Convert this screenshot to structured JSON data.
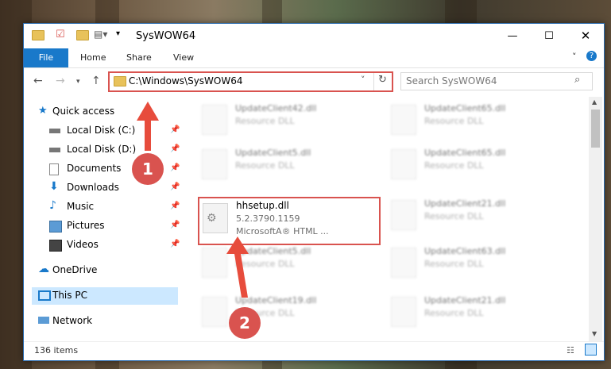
{
  "window": {
    "title": "SysWOW64"
  },
  "ribbon": {
    "file": "File",
    "home": "Home",
    "share": "Share",
    "view": "View"
  },
  "address": {
    "path": "C:\\Windows\\SysWOW64"
  },
  "search": {
    "placeholder": "Search SysWOW64"
  },
  "sidebar": {
    "items": [
      {
        "label": "Quick access",
        "icon": "star-icon"
      },
      {
        "label": "Local Disk (C:)",
        "icon": "drive-icon"
      },
      {
        "label": "Local Disk (D:)",
        "icon": "drive-icon"
      },
      {
        "label": "Documents",
        "icon": "document-icon"
      },
      {
        "label": "Downloads",
        "icon": "download-icon"
      },
      {
        "label": "Music",
        "icon": "music-icon"
      },
      {
        "label": "Pictures",
        "icon": "picture-icon"
      },
      {
        "label": "Videos",
        "icon": "video-icon"
      },
      {
        "label": "OneDrive",
        "icon": "cloud-icon"
      },
      {
        "label": "This PC",
        "icon": "computer-icon"
      },
      {
        "label": "Network",
        "icon": "network-icon"
      }
    ]
  },
  "files": [
    {
      "name": "UpdateClient42.dll",
      "desc": "Resource DLL"
    },
    {
      "name": "UpdateClient65.dll",
      "desc": "Resource DLL"
    },
    {
      "name": "UpdateClient5.dll",
      "desc": "Resource DLL"
    },
    {
      "name": "UpdateClient65.dll",
      "desc": "Resource DLL"
    },
    {
      "name": "hhsetup.dll",
      "version": "5.2.3790.1159",
      "desc": "MicrosoftA® HTML ..."
    },
    {
      "name": "UpdateClient21.dll",
      "desc": "Resource DLL"
    },
    {
      "name": "UpdateClient5.dll",
      "desc": "Resource DLL"
    },
    {
      "name": "UpdateClient63.dll",
      "desc": "Resource DLL"
    },
    {
      "name": "UpdateClient19.dll",
      "desc": "Resource DLL"
    },
    {
      "name": "UpdateClient21.dll",
      "desc": "Resource DLL"
    }
  ],
  "status": {
    "count": "136 items"
  },
  "annotations": {
    "one": "1",
    "two": "2"
  },
  "colors": {
    "accent": "#1979ca",
    "highlight": "#d9534f",
    "selection": "#cce8ff"
  }
}
